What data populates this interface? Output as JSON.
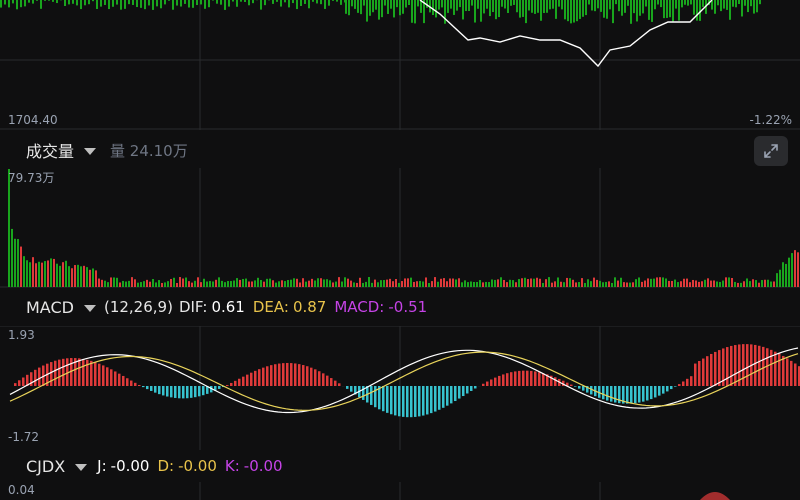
{
  "price_panel": {
    "low_price_label": "1704.40",
    "change_label": "-1.22%"
  },
  "volume": {
    "name": "成交量",
    "metric_label": "量 24.10万",
    "max_label": "79.73万",
    "expand_icon": "expand-diagonal-icon"
  },
  "macd": {
    "name": "MACD",
    "params": "(12,26,9)",
    "dif_label": "DIF:",
    "dif_value": "0.61",
    "dea_label": "DEA:",
    "dea_value": "0.87",
    "macd_label": "MACD:",
    "macd_value": "-0.51",
    "top_label": "1.93",
    "bottom_label": "-1.72"
  },
  "cjdx": {
    "name": "CJDX",
    "j_label": "J:",
    "j_value": "-0.00",
    "d_label": "D:",
    "d_value": "-0.00",
    "k_label": "K:",
    "k_value": "-0.00",
    "top_label": "0.04"
  },
  "colors": {
    "background": "#0f0f10",
    "grid": "#2a2b2e",
    "up": "#e03a3a",
    "down": "#19a51d",
    "macd_neg": "#37c3cf",
    "dif_line": "#ffffff",
    "dea_line": "#e8d35a",
    "dea_text": "#e8c34b",
    "macd_text": "#c543e6",
    "price_line": "#ffffff"
  }
}
